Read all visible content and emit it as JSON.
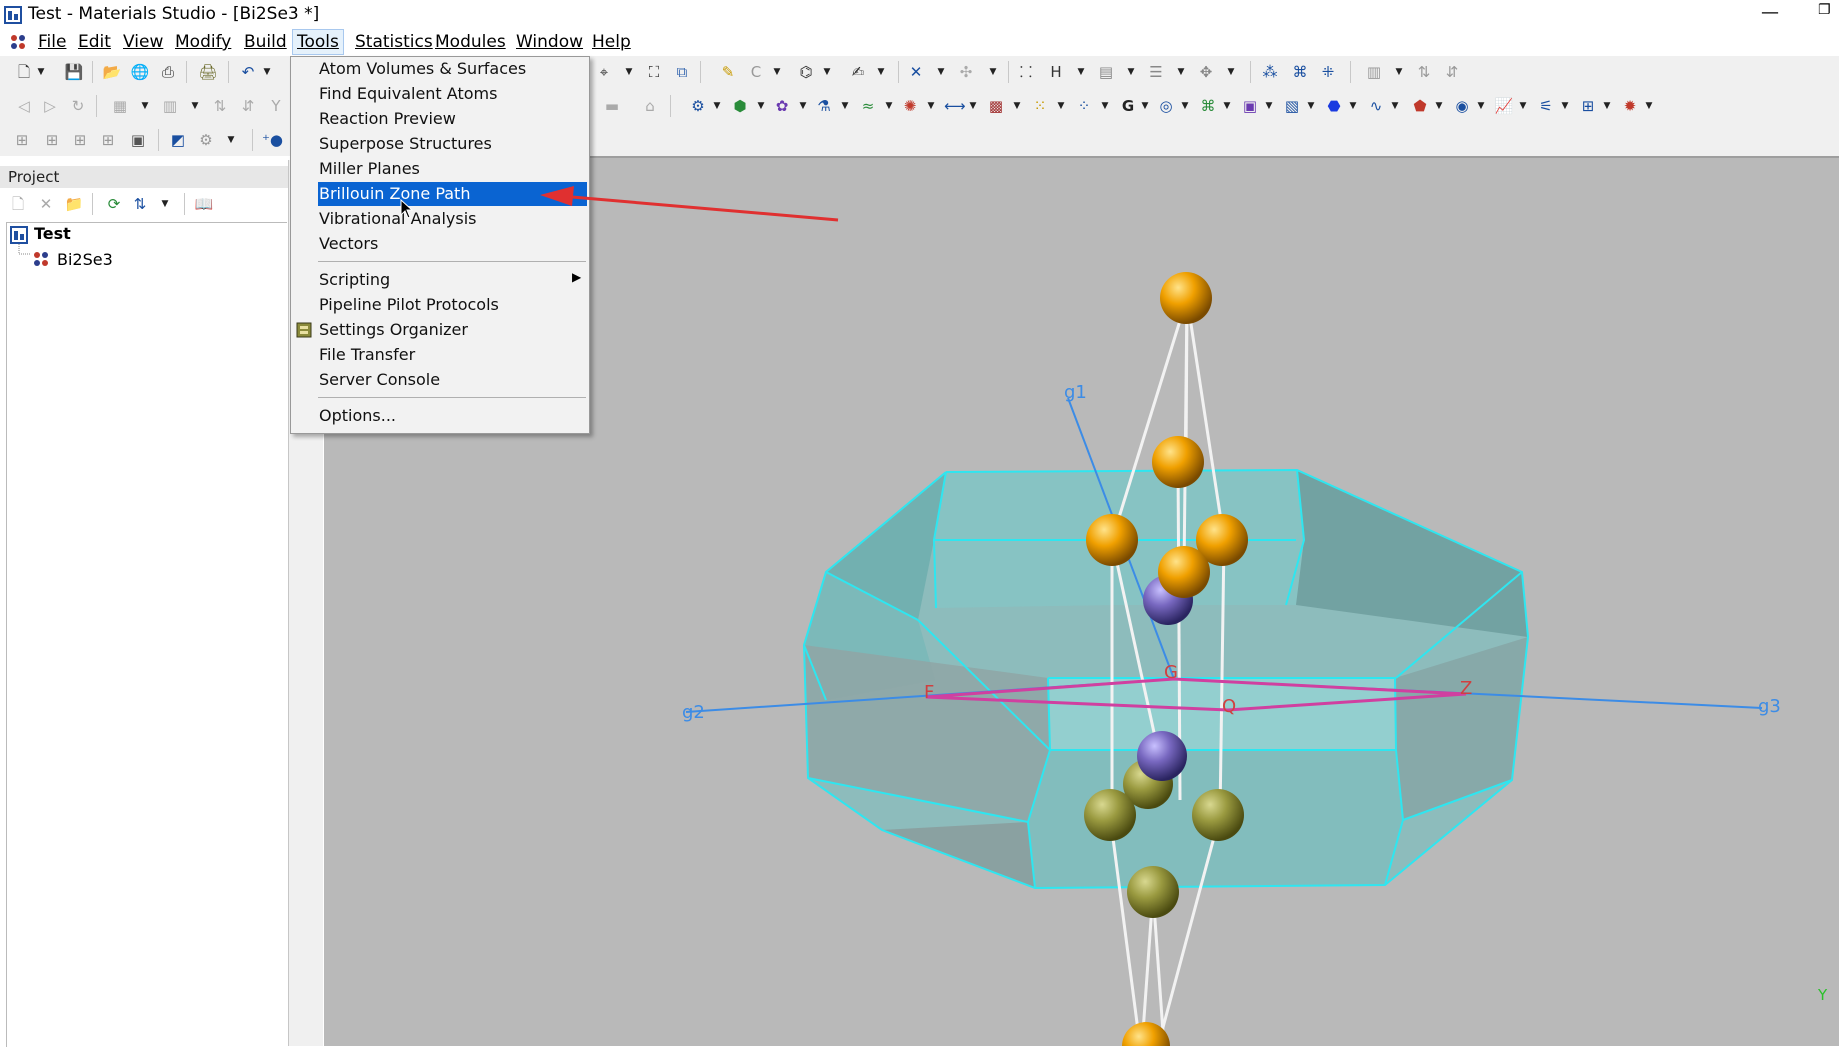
{
  "window": {
    "title": "Test - Materials Studio - [Bi2Se3 *]",
    "minimize_glyph": "—",
    "restore_glyph": "❐"
  },
  "menubar": {
    "items": [
      "File",
      "Edit",
      "View",
      "Modify",
      "Build",
      "Tools",
      "Statistics",
      "Modules",
      "Window",
      "Help"
    ],
    "active": "Tools"
  },
  "tools_menu": {
    "items": [
      {
        "label": "Atom Volumes & Surfaces"
      },
      {
        "label": "Find Equivalent Atoms"
      },
      {
        "label": "Reaction Preview"
      },
      {
        "label": "Superpose Structures"
      },
      {
        "label": "Miller Planes"
      },
      {
        "label": "Brillouin Zone Path",
        "highlighted": true
      },
      {
        "label": "Vibrational Analysis"
      },
      {
        "label": "Vectors"
      },
      {
        "label": "Scripting",
        "submenu": true
      },
      {
        "label": "Pipeline Pilot Protocols"
      },
      {
        "label": "Settings Organizer"
      },
      {
        "label": "File Transfer"
      },
      {
        "label": "Server Console"
      },
      {
        "label": "Options..."
      }
    ]
  },
  "project": {
    "header": "Project",
    "root": "Test",
    "document": "Bi2Se3"
  },
  "viewer": {
    "axis_labels": {
      "g1": "g1",
      "g2": "g2",
      "g3": "g3"
    },
    "point_labels": {
      "F": "F",
      "G": "G",
      "Q": "Q",
      "Z": "Z"
    },
    "axis_corner": "Y",
    "colors": {
      "background": "#b9b9b9",
      "zone_edge": "#2ee6f0",
      "zone_fill": "#7fbfbf",
      "atom_se": "#f0a000",
      "atom_bi": "#8878c8",
      "path": "#d040a0",
      "axis": "#3c8ce6",
      "highlight": "#0a64d2",
      "arrow": "#e03030"
    }
  }
}
